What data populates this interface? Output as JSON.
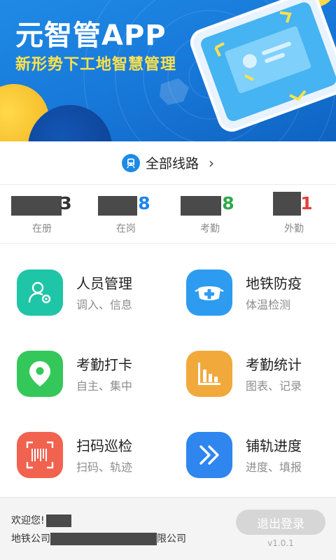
{
  "banner": {
    "title": "元智管APP",
    "subtitle": "新形势下工地智慧管理"
  },
  "route": {
    "label": "全部线路",
    "chevron": "›",
    "icon": "metro-train-icon"
  },
  "stats": [
    {
      "value": "3",
      "label": "在册",
      "color": "#333333"
    },
    {
      "value": "8",
      "label": "在岗",
      "color": "#1e86e6"
    },
    {
      "value": "8",
      "label": "考勤",
      "color": "#2ea84a"
    },
    {
      "value": "1",
      "label": "外勤",
      "color": "#e5403a"
    }
  ],
  "modules": [
    {
      "title": "人员管理",
      "desc": "调入、信息",
      "icon": "user-settings-icon",
      "color": "#1fc5a7"
    },
    {
      "title": "地铁防疫",
      "desc": "体温检测",
      "icon": "mask-icon",
      "color": "#2d9cf0"
    },
    {
      "title": "考勤打卡",
      "desc": "自主、集中",
      "icon": "location-pin-icon",
      "color": "#34c85a"
    },
    {
      "title": "考勤统计",
      "desc": "图表、记录",
      "icon": "bar-chart-icon",
      "color": "#f2a93b"
    },
    {
      "title": "扫码巡检",
      "desc": "扫码、轨迹",
      "icon": "barcode-scan-icon",
      "color": "#f1624f"
    },
    {
      "title": "铺轨进度",
      "desc": "进度、填报",
      "icon": "double-chevron-right-icon",
      "color": "#2e86ee"
    }
  ],
  "footer": {
    "welcome": "欢迎您!",
    "company_prefix": "地铁公司",
    "company_suffix": "限公司",
    "logout_label": "退出登录",
    "version": "v1.0.1"
  }
}
